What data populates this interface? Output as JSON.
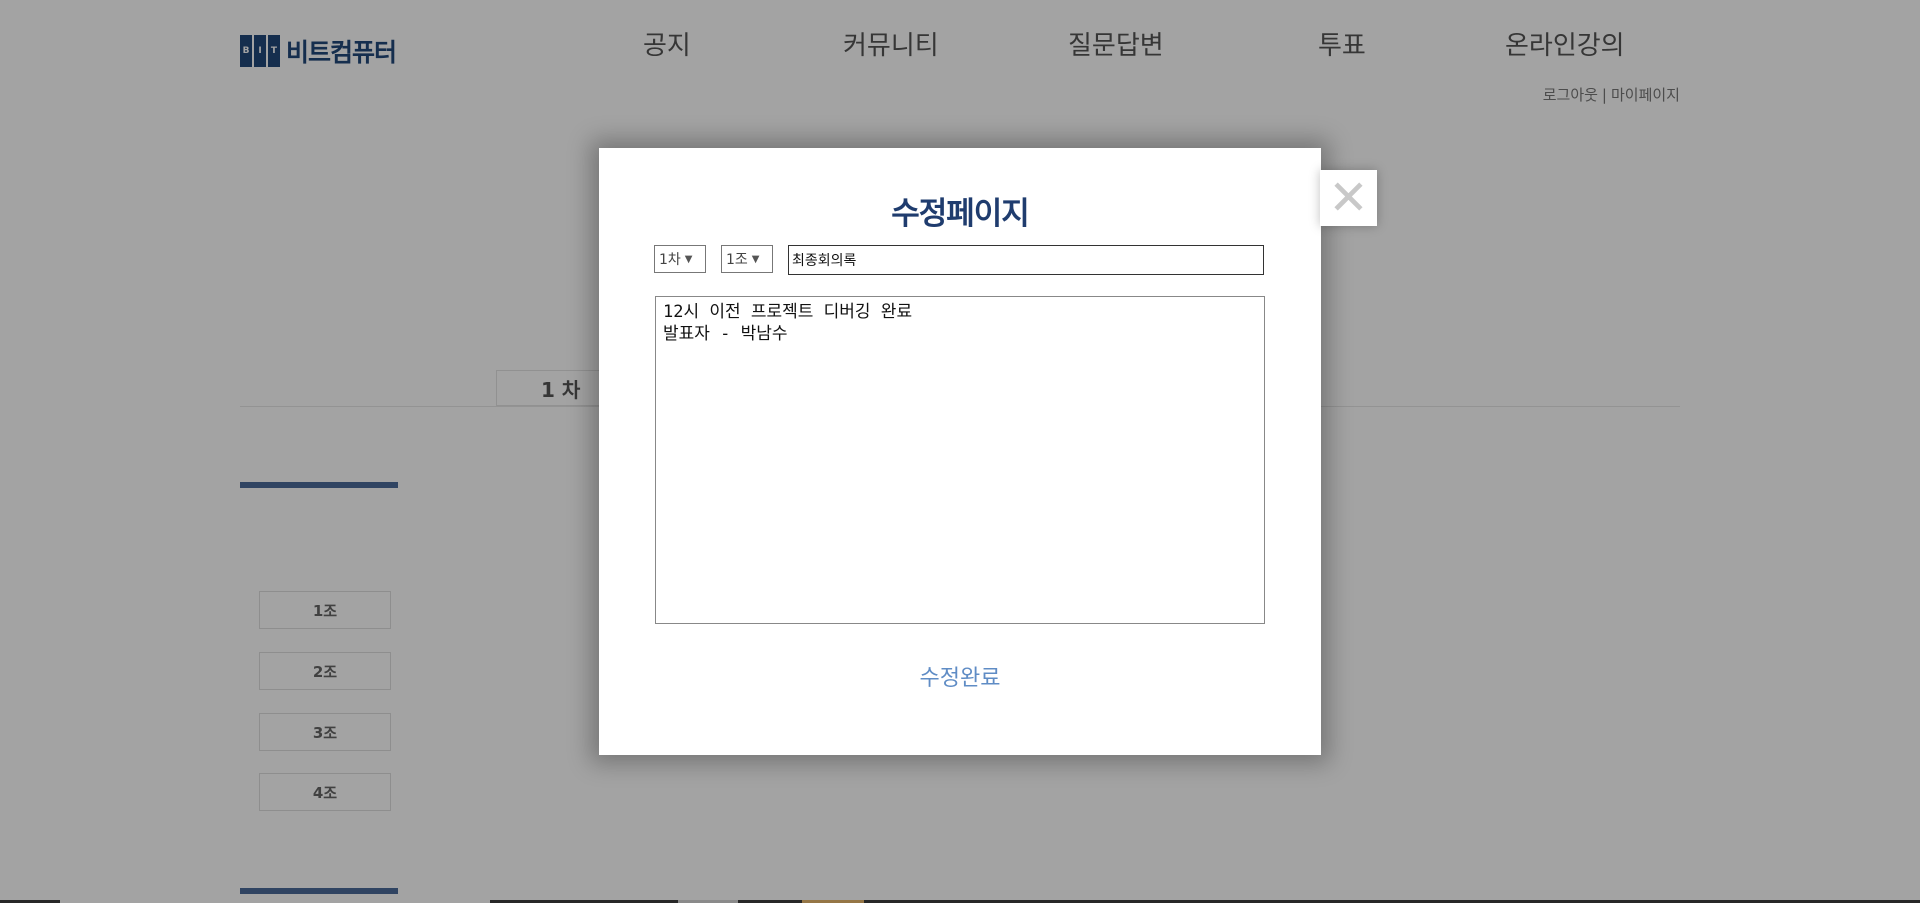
{
  "logo": {
    "mark": [
      "B",
      "I",
      "T"
    ],
    "text": "비트컴퓨터"
  },
  "nav": [
    "공지",
    "커뮤니티",
    "질문답변",
    "투표",
    "온라인강의"
  ],
  "util": {
    "logout": "로그아웃",
    "separator": "|",
    "mypage": "마이페이지"
  },
  "round_tab": "1 차",
  "sidebar_teams": [
    "1조",
    "2조",
    "3조",
    "4조"
  ],
  "modal": {
    "title": "수정페이지",
    "round_select": "1차",
    "team_select": "1조",
    "title_value": "최종회의록",
    "content_lines": [
      "12시 이전 프로젝트 디버깅 완료",
      "발표자 - 박남수"
    ],
    "submit_label": "수정완료",
    "close_icon": "close-icon"
  },
  "colors": {
    "brand": "#22487a",
    "modal_title": "#1f3c6e",
    "submit": "#5f8cc5"
  }
}
